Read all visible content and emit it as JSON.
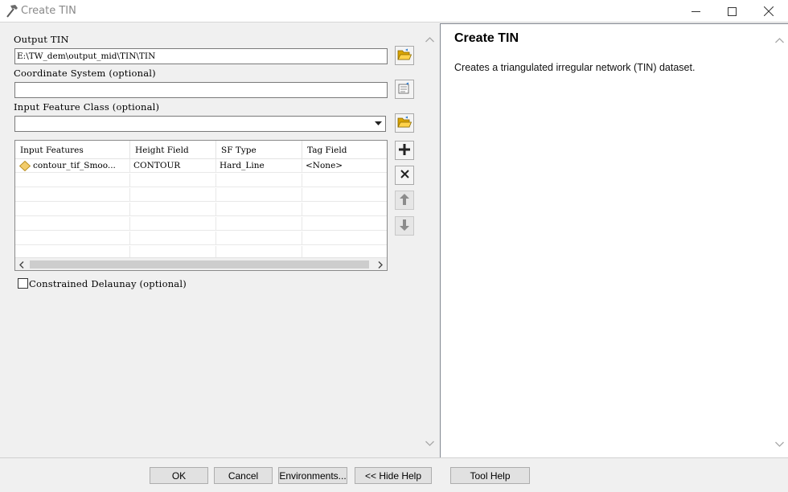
{
  "window": {
    "title": "Create TIN",
    "icons": {
      "app": "hammer-icon",
      "minimize": "minimize-icon",
      "maximize": "maximize-icon",
      "close": "close-icon"
    }
  },
  "form": {
    "output_tin": {
      "label": "Output TIN",
      "value": "E:\\TW_dem\\output_mid\\TIN\\TIN"
    },
    "coordinate_system": {
      "label": "Coordinate System (optional)",
      "value": ""
    },
    "input_feature_class": {
      "label": "Input Feature Class (optional)",
      "selected": ""
    },
    "features_table": {
      "columns": [
        "Input Features",
        "Height Field",
        "SF Type",
        "Tag Field"
      ],
      "rows": [
        {
          "input_features": "contour_tif_Smoo...",
          "height_field": "CONTOUR",
          "sf_type": "Hard_Line",
          "tag_field": "<None>",
          "icon": "polygon-feature-icon"
        }
      ]
    },
    "constrained_delaunay": {
      "label": "Constrained Delaunay (optional)",
      "checked": false
    }
  },
  "side_buttons": [
    "add-icon",
    "remove-icon",
    "move-up-icon",
    "move-down-icon"
  ],
  "help": {
    "title": "Create TIN",
    "description": "Creates a triangulated irregular network (TIN) dataset."
  },
  "buttons": {
    "ok": "OK",
    "cancel": "Cancel",
    "environments": "Environments...",
    "hide_help": "<< Hide Help",
    "tool_help": "Tool Help"
  }
}
